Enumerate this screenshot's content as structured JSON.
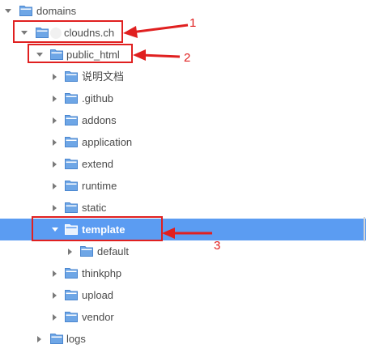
{
  "tree": {
    "root": {
      "label": "domains",
      "expanded": true
    },
    "site": {
      "label": "cloudns.ch",
      "expanded": true
    },
    "public_html": {
      "label": "public_html",
      "expanded": true
    },
    "children": [
      {
        "label": "说明文档",
        "expanded": false
      },
      {
        "label": ".github",
        "expanded": false
      },
      {
        "label": "addons",
        "expanded": false
      },
      {
        "label": "application",
        "expanded": false
      },
      {
        "label": "extend",
        "expanded": false
      },
      {
        "label": "runtime",
        "expanded": false
      },
      {
        "label": "static",
        "expanded": false
      }
    ],
    "template": {
      "label": "template",
      "expanded": true,
      "selected": true
    },
    "template_children": [
      {
        "label": "default",
        "expanded": false
      }
    ],
    "after_template": [
      {
        "label": "thinkphp",
        "expanded": false
      },
      {
        "label": "upload",
        "expanded": false
      },
      {
        "label": "vendor",
        "expanded": false
      }
    ],
    "logs": {
      "label": "logs",
      "expanded": false
    }
  },
  "annotations": [
    {
      "number": "1"
    },
    {
      "number": "2"
    },
    {
      "number": "3"
    }
  ],
  "colors": {
    "selection": "#5b9cf2",
    "annotation": "#e02020",
    "folder_fill": "#6ea6e6",
    "folder_outline": "#4a86cf",
    "caret": "#7a7a7a"
  },
  "icons": {
    "folder": "folder-icon",
    "expanded": "caret-down-icon",
    "collapsed": "caret-right-icon"
  }
}
